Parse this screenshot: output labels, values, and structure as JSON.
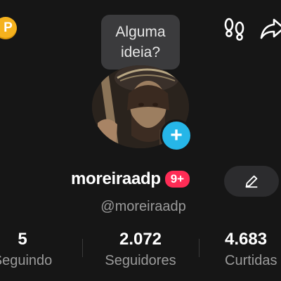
{
  "colors": {
    "background": "#161616",
    "accent_blue": "#26b6e8",
    "badge_red": "#fe2c55",
    "coin_gold": "#f5b21e"
  },
  "header": {
    "coin_icon": "coin-icon",
    "coin_letter": "P",
    "footprints_icon": "footprints-icon",
    "share_icon": "share-icon"
  },
  "tooltip": {
    "line1": "Alguma",
    "line2": "ideia?"
  },
  "profile": {
    "username": "moreiraadp",
    "notification_count": "9+",
    "handle": "@moreiraadp",
    "avatar_icon": "avatar-photo",
    "add_icon": "plus-icon",
    "edit_icon": "pencil-icon"
  },
  "stats": [
    {
      "value": "5",
      "label": "Seguindo"
    },
    {
      "value": "2.072",
      "label": "Seguidores"
    },
    {
      "value": "4.683",
      "label": "Curtidas"
    }
  ]
}
